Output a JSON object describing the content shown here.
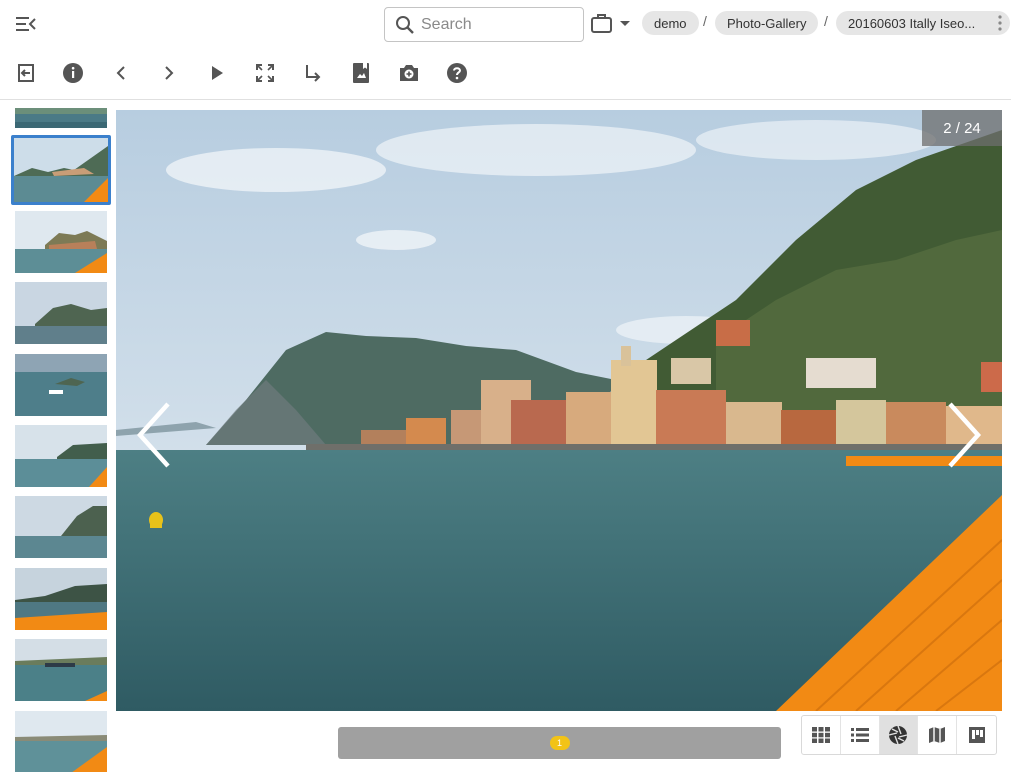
{
  "header": {
    "search_placeholder": "Search",
    "breadcrumbs": [
      "demo",
      "Photo-Gallery",
      "20160603 Itally Iseo..."
    ],
    "separator": "/"
  },
  "toolbar": {
    "icons": [
      "exit-icon",
      "info-icon",
      "previous-icon",
      "next-icon",
      "play-icon",
      "fullscreen-icon",
      "move-icon",
      "bookmark-icon",
      "add-photo-icon",
      "help-icon"
    ]
  },
  "viewer": {
    "counter": "2 / 24",
    "current_index": 2,
    "total": 24
  },
  "thumbnails": {
    "count": 10,
    "selected_index": 1
  },
  "pager": {
    "current_page": "1"
  },
  "view_modes": [
    "grid-view",
    "list-view",
    "photo-view",
    "map-view",
    "board-view"
  ],
  "active_view": "photo-view",
  "colors": {
    "selected_border": "#3b80cc",
    "pager_bg": "#a0a0a0",
    "badge": "#f2c317",
    "walkway_orange": "#f28a14"
  }
}
